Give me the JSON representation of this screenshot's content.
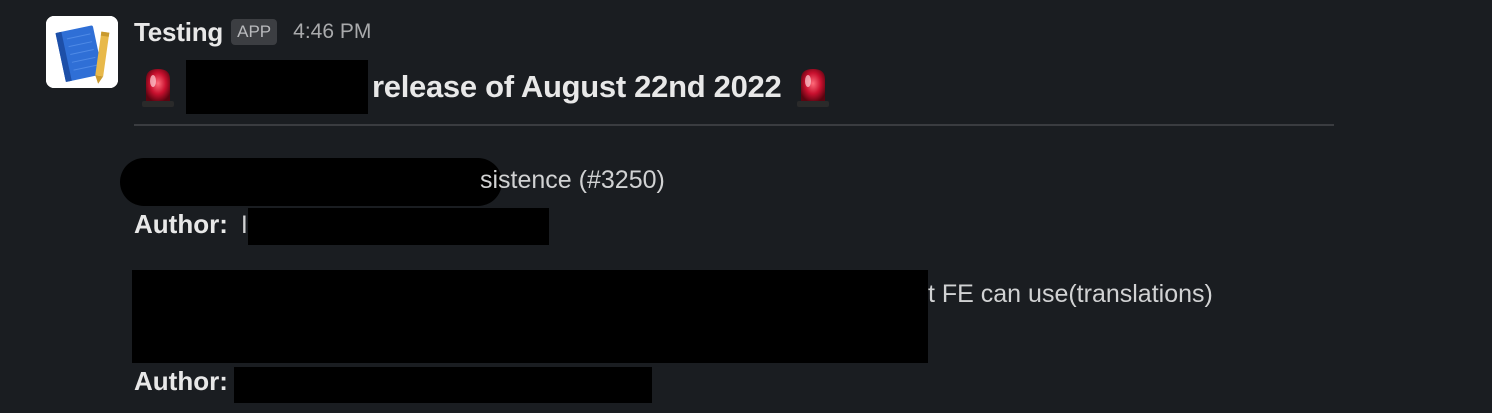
{
  "message": {
    "sender": "Testing",
    "badge": "APP",
    "time": "4:46 PM",
    "title_suffix": "release of August 22nd 2022",
    "icons": [
      "book-app-icon",
      "rotating-light-emoji"
    ]
  },
  "changes": [
    {
      "visible_fragment": "sistence (#3250)",
      "author_label": "Author:",
      "author_visible_prefix": "I"
    },
    {
      "visible_fragment": "t FE can use(translations)",
      "author_label": "Author:"
    }
  ],
  "colors": {
    "background": "#1a1d21",
    "text": "#d1d2d3",
    "badge_bg": "#3c3e42",
    "siren_red": "#c8102e",
    "redaction": "#000000"
  }
}
